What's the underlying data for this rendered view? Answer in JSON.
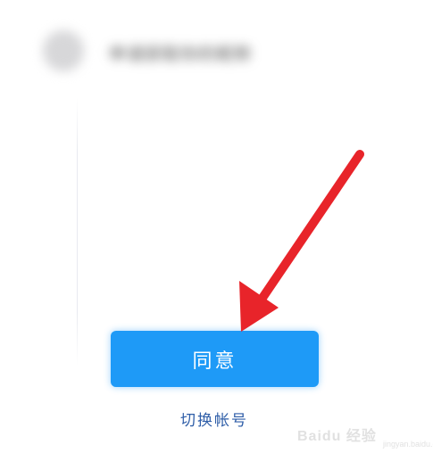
{
  "header": {
    "blurred_text": "申请获取你的昵称"
  },
  "actions": {
    "agree_label": "同意",
    "switch_account_label": "切换帐号"
  },
  "colors": {
    "agree_button": "#1e9af7",
    "switch_link": "#2f5ea8",
    "annotation_arrow": "#e8242a"
  },
  "watermark": {
    "text": "Baidu 经验",
    "sub": "jingyan.baidu.com"
  }
}
